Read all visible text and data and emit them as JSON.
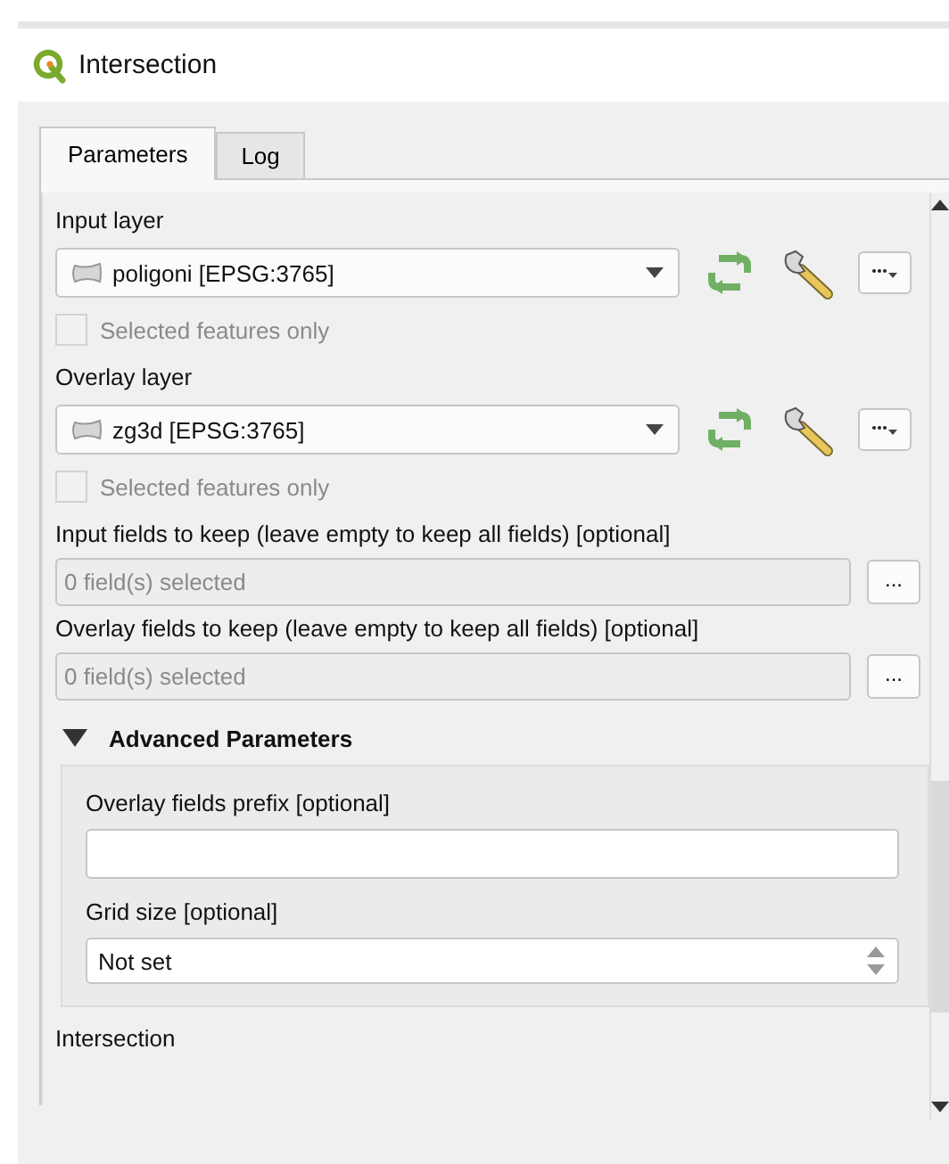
{
  "window": {
    "title": "Intersection"
  },
  "tabs": [
    {
      "label": "Parameters",
      "selected": true
    },
    {
      "label": "Log",
      "selected": false
    }
  ],
  "layers": [
    {
      "label": "Input layer",
      "value": "poligoni [EPSG:3765]",
      "option": {
        "label": "Selected features only",
        "checked": false,
        "disabled": true
      }
    },
    {
      "label": "Overlay layer",
      "value": "zg3d [EPSG:3765]",
      "option": {
        "label": "Selected features only",
        "checked": false,
        "disabled": true
      }
    }
  ],
  "field_lists": [
    {
      "label": "Input fields to keep (leave empty to keep all fields) [optional]",
      "value": "0 field(s) selected",
      "button": "..."
    },
    {
      "label": "Overlay fields to keep (leave empty to keep all fields) [optional]",
      "value": "0 field(s) selected",
      "button": "..."
    }
  ],
  "advanced": {
    "title": "Advanced Parameters",
    "expanded": true,
    "fields": [
      {
        "kind": "text",
        "label": "Overlay fields prefix [optional]"
      },
      {
        "kind": "spin",
        "label": "Grid size [optional]",
        "value": "Not set"
      }
    ]
  },
  "footer": "Intersection"
}
